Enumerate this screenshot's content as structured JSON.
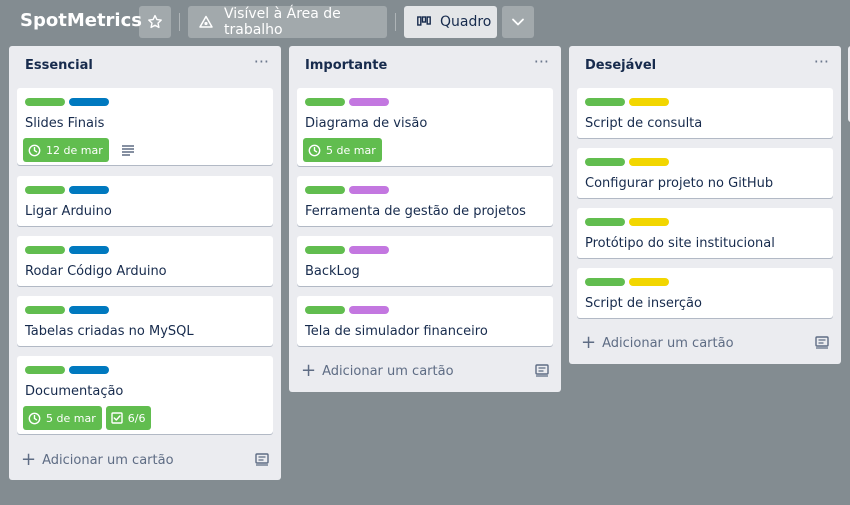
{
  "header": {
    "title": "SpotMetrics",
    "visibility_label": "Visível à Área de trabalho",
    "view_label": "Quadro"
  },
  "colors": {
    "background": "#838c91",
    "label_green": "#61bd4f",
    "label_blue": "#0079bf",
    "label_purple": "#c377e0",
    "label_yellow": "#f2d600",
    "badge_green": "#61bd4f"
  },
  "lists": [
    {
      "title": "Essencial",
      "menu": "···",
      "add_label": "Adicionar um cartão",
      "cards": [
        {
          "title": "Slides Finais",
          "labels": [
            "green",
            "blue"
          ],
          "due": "12 de mar",
          "has_description": true
        },
        {
          "title": "Ligar Arduino",
          "labels": [
            "green",
            "blue"
          ]
        },
        {
          "title": "Rodar Código Arduino",
          "labels": [
            "green",
            "blue"
          ]
        },
        {
          "title": "Tabelas criadas no MySQL",
          "labels": [
            "green",
            "blue"
          ]
        },
        {
          "title": "Documentação",
          "labels": [
            "green",
            "blue"
          ],
          "due": "5 de mar",
          "checklist": "6/6"
        }
      ]
    },
    {
      "title": "Importante",
      "menu": "···",
      "add_label": "Adicionar um cartão",
      "cards": [
        {
          "title": "Diagrama de visão",
          "labels": [
            "green",
            "purple"
          ],
          "due": "5 de mar"
        },
        {
          "title": "Ferramenta de gestão de projetos",
          "labels": [
            "green",
            "purple"
          ]
        },
        {
          "title": "BackLog",
          "labels": [
            "green",
            "purple"
          ]
        },
        {
          "title": "Tela de simulador financeiro",
          "labels": [
            "green",
            "purple"
          ]
        }
      ]
    },
    {
      "title": "Desejável",
      "menu": "···",
      "add_label": "Adicionar um cartão",
      "cards": [
        {
          "title": "Script de consulta",
          "labels": [
            "green",
            "yellow"
          ]
        },
        {
          "title": "Configurar projeto no GitHub",
          "labels": [
            "green",
            "yellow"
          ]
        },
        {
          "title": "Protótipo do site institucional",
          "labels": [
            "green",
            "yellow"
          ]
        },
        {
          "title": "Script de inserção",
          "labels": [
            "green",
            "yellow"
          ]
        }
      ]
    }
  ]
}
